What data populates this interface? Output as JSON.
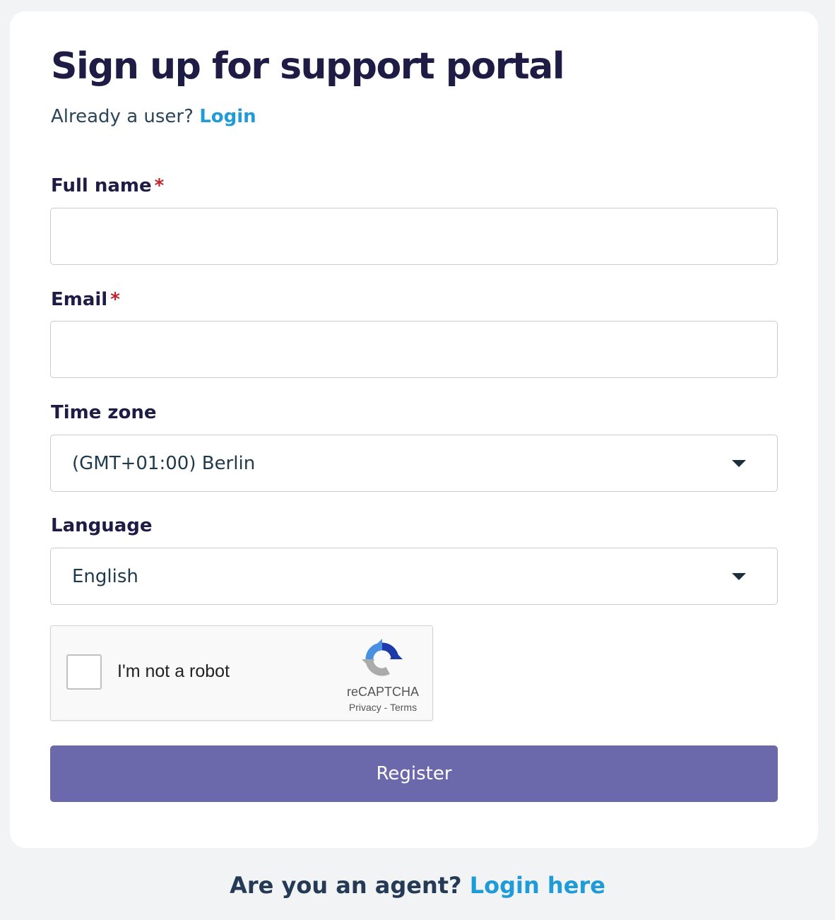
{
  "page": {
    "title": "Sign up for support portal",
    "already_user_text": "Already a user?",
    "login_link": "Login"
  },
  "form": {
    "full_name": {
      "label": "Full name",
      "required_mark": "*",
      "value": ""
    },
    "email": {
      "label": "Email",
      "required_mark": "*",
      "value": ""
    },
    "time_zone": {
      "label": "Time zone",
      "selected": "(GMT+01:00) Berlin"
    },
    "language": {
      "label": "Language",
      "selected": "English"
    },
    "captcha": {
      "checkbox_label": "I'm not a robot",
      "brand": "reCAPTCHA",
      "privacy_link": "Privacy",
      "separator": "-",
      "terms_link": "Terms",
      "checked": false
    },
    "register_label": "Register"
  },
  "footer": {
    "question": "Are you an agent?",
    "login_here_link": "Login here"
  },
  "colors": {
    "background": "#f2f3f5",
    "card": "#ffffff",
    "heading": "#1e1b45",
    "link": "#1f9bd7",
    "required": "#c0242b",
    "button": "#6b68ab"
  }
}
